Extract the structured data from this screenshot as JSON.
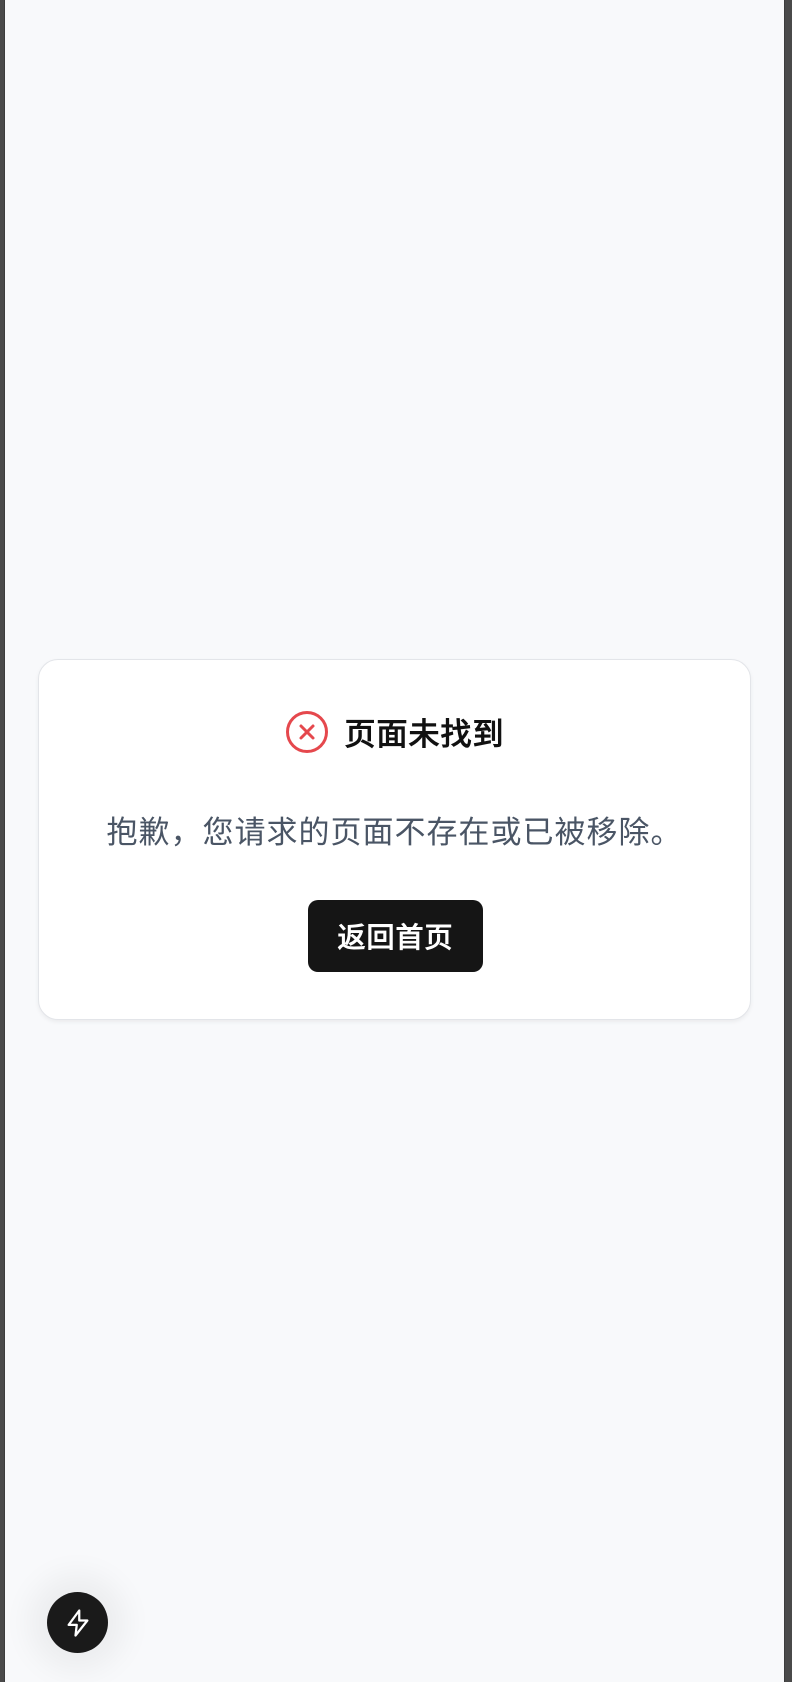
{
  "card": {
    "title": "页面未找到",
    "message": "抱歉，您请求的页面不存在或已被移除。",
    "home_button_label": "返回首页",
    "error_icon": "x-circle-icon"
  },
  "fab": {
    "icon": "lightning-bolt-icon"
  },
  "colors": {
    "page_background": "#f8f9fb",
    "card_background": "#ffffff",
    "error_red": "#e5484d",
    "button_background": "#151515",
    "message_text": "#4a5565"
  }
}
